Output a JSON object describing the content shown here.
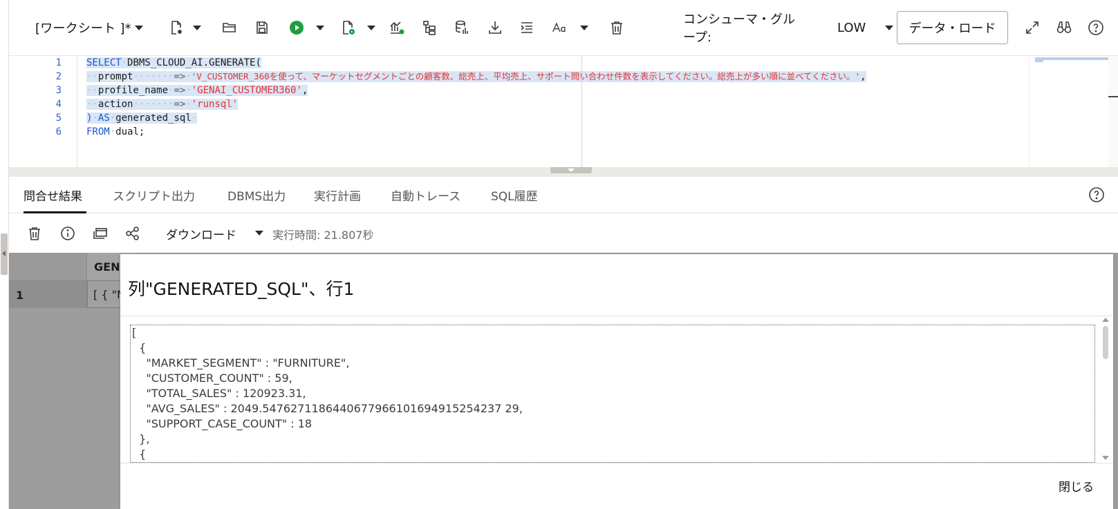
{
  "toolbar": {
    "worksheet_label": "[ワークシート ]*",
    "consumer_group_label": "コンシューマ・グループ:",
    "consumer_group_value": "LOW",
    "data_load_label": "データ・ロード"
  },
  "editor": {
    "line_numbers": [
      "1",
      "2",
      "3",
      "4",
      "5",
      "6"
    ],
    "lines": {
      "l1_kw": "SELECT",
      "l1_fn": "DBMS_CLOUD_AI.GENERATE(",
      "l2_key": "prompt",
      "l2_arrow": "=>",
      "l2_str": "'V_CUSTOMER_360を使って、マーケットセグメントごとの顧客数、総売上、平均売上、サポート問い合わせ件数を表示してください。総売上が多い順に並べてください。'",
      "l2_comma": ",",
      "l3_key": "profile_name",
      "l3_arrow": "=>",
      "l3_str": "'GENAI_CUSTOMER360'",
      "l3_comma": ",",
      "l4_key": "action",
      "l4_arrow": "=>",
      "l4_str": "'runsql'",
      "l5_paren": ")",
      "l5_kw": "AS",
      "l5_alias": "generated_sql",
      "l6_kw": "FROM",
      "l6_tbl": "dual;"
    }
  },
  "tabs": {
    "query_result": "問合せ結果",
    "script_output": "スクリプト出力",
    "dbms_output": "DBMS出力",
    "explain_plan": "実行計画",
    "autotrace": "自動トレース",
    "sql_history": "SQL履歴"
  },
  "results_toolbar": {
    "download_label": "ダウンロード",
    "exec_time": "実行時間: 21.807秒"
  },
  "grid": {
    "column_header": "GENERATED_SQL",
    "row_number": "1",
    "cell_value": "[ { \"MARKET_SEGMENT\""
  },
  "dialog": {
    "title": "列\"GENERATED_SQL\"、行1",
    "json_lines": [
      "[",
      "  {",
      "    \"MARKET_SEGMENT\" : \"FURNITURE\",",
      "    \"CUSTOMER_COUNT\" : 59,",
      "    \"TOTAL_SALES\" : 120923.31,",
      "    \"AVG_SALES\" : 2049.5476271186440677966101694915254237 29,",
      "    \"SUPPORT_CASE_COUNT\" : 18",
      "  },",
      "  {"
    ],
    "close_label": "閉じる"
  },
  "colors": {
    "run_green": "#1e9e3e",
    "keyword_blue": "#1b55c9",
    "string_red": "#e23333",
    "selection": "#d8e6f6"
  }
}
